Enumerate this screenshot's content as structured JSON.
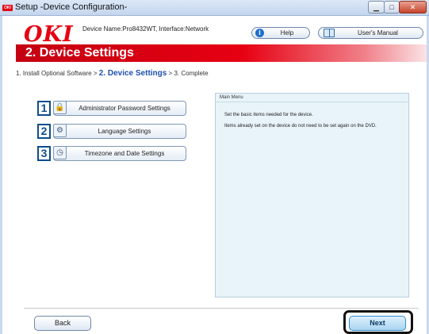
{
  "window": {
    "logo_text": "OKI",
    "title": "Setup -Device Configuration-",
    "minimize_glyph": "▁",
    "maximize_glyph": "□",
    "close_glyph": "✕"
  },
  "header": {
    "logo": "OKI",
    "device_info": "Device Name:Pro8432WT, Interface:Network",
    "help_label": "Help",
    "help_icon": "i",
    "manual_label": "User's Manual"
  },
  "banner": {
    "title": "2. Device Settings"
  },
  "breadcrumb": {
    "step1": "1. Install Optional Software > ",
    "current": "2. Device Settings",
    "step3": " > 3. Complete"
  },
  "menu": {
    "items": [
      {
        "number": "1",
        "icon": "lock-icon",
        "icon_glyph": "🔒",
        "label": "Administrator Password Settings"
      },
      {
        "number": "2",
        "icon": "language-icon",
        "icon_glyph": "⚙",
        "label": "Language Settings"
      },
      {
        "number": "3",
        "icon": "clock-icon",
        "icon_glyph": "◷",
        "label": "Timezone and Date Settings"
      }
    ]
  },
  "panel": {
    "title": "Main Menu",
    "line1": "Set the basic items needed for the device.",
    "line2": "Items already set on the device do not need to be set again on the DVD."
  },
  "footer": {
    "back_label": "Back",
    "next_label": "Next"
  },
  "colors": {
    "brand_red": "#e60012",
    "accent_blue": "#1e50b0",
    "panel_bg": "#e8f4f9"
  }
}
